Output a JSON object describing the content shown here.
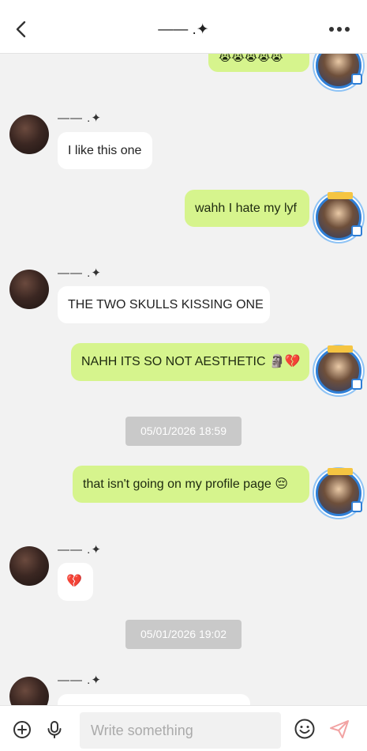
{
  "header": {
    "title": "—— .✦"
  },
  "messages": [
    {
      "side": "right",
      "text": "😭😭😭😭😭",
      "partial": true
    },
    {
      "side": "left",
      "sender": "—— .✦",
      "text": "I like this one"
    },
    {
      "side": "right",
      "text": "wahh I hate my lyf"
    },
    {
      "side": "left",
      "sender": "—— .✦",
      "text": "THE TWO SKULLS KISSING ONE"
    },
    {
      "side": "right",
      "text": "NAHH ITS SO NOT AESTHETIC 🗿💔"
    },
    {
      "type": "timestamp",
      "text": "05/01/2026 18:59"
    },
    {
      "side": "right",
      "text": "that isn't going on my profile page 😔"
    },
    {
      "side": "left",
      "sender": "—— .✦",
      "text": "💔"
    },
    {
      "type": "timestamp",
      "text": "05/01/2026 19:02"
    },
    {
      "side": "left",
      "sender": "—— .✦",
      "text": "",
      "partial": true
    }
  ],
  "composer": {
    "placeholder": "Write something"
  },
  "icons": {
    "back": "chevron-left-icon",
    "more": "more-dots-icon",
    "add": "plus-circle-icon",
    "mic": "microphone-icon",
    "emoji": "emoji-icon",
    "send": "send-icon"
  },
  "colors": {
    "own_bubble": "#d6f48d",
    "other_bubble": "#ffffff",
    "background": "#f2f2f2",
    "timestamp_bg": "#c9c9c9"
  }
}
